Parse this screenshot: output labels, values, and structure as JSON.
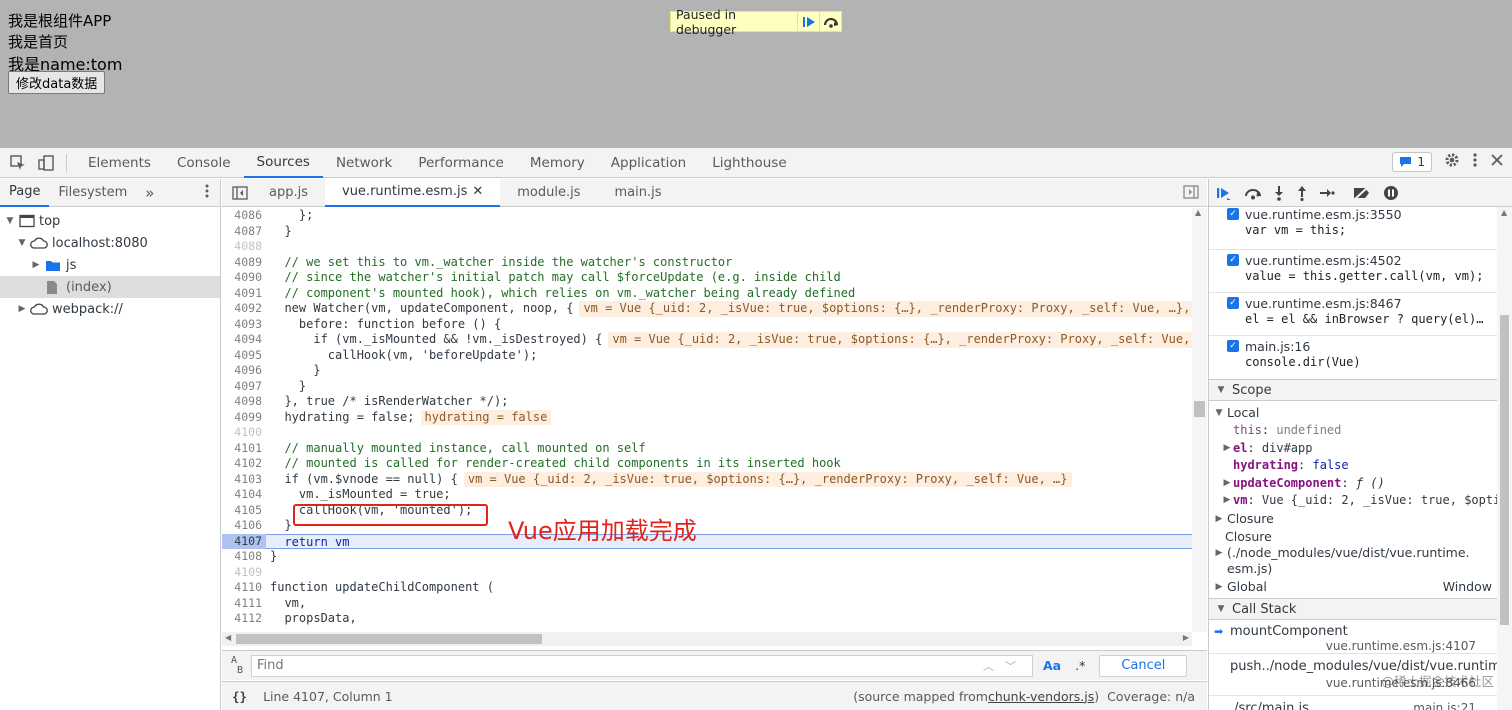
{
  "page": {
    "line1": "我是根组件APP",
    "line2": "我是首页",
    "line3": "我是name:tom",
    "button_label": "修改data数据",
    "paused_text": "Paused in debugger"
  },
  "devtools": {
    "tabs": [
      "Elements",
      "Console",
      "Sources",
      "Network",
      "Performance",
      "Memory",
      "Application",
      "Lighthouse"
    ],
    "active_tab": "Sources",
    "message_count": "1"
  },
  "navigator": {
    "tabs": [
      "Page",
      "Filesystem"
    ],
    "tree": {
      "top": "top",
      "host": "localhost:8080",
      "js": "js",
      "index": "(index)",
      "webpack": "webpack://"
    }
  },
  "editor": {
    "file_tabs": [
      "app.js",
      "vue.runtime.esm.js",
      "module.js",
      "main.js"
    ],
    "active_file": "vue.runtime.esm.js",
    "annotation": "Vue应用加载完成",
    "find_placeholder": "Find",
    "find_case": "Aa",
    "find_regex": ".*",
    "cancel_label": "Cancel",
    "status_position": "Line 4107, Column 1",
    "status_mapped_prefix": "(source mapped from ",
    "status_mapped_file": "chunk-vendors.js",
    "status_mapped_suffix": ")",
    "status_coverage": "Coverage: n/a"
  },
  "code_lines": [
    {
      "n": "4086",
      "t": "    };"
    },
    {
      "n": "4087",
      "t": "  }"
    },
    {
      "n": "4088",
      "t": ""
    },
    {
      "n": "4089",
      "t": "  // we set this to vm._watcher inside the watcher's constructor"
    },
    {
      "n": "4090",
      "t": "  // since the watcher's initial patch may call $forceUpdate (e.g. inside child"
    },
    {
      "n": "4091",
      "t": "  // component's mounted hook), which relies on vm._watcher being already defined"
    },
    {
      "n": "4092",
      "t": "  new Watcher(vm, updateComponent, noop, {",
      "i": "vm = Vue {_uid: 2, _isVue: true, $options: {…}, _renderProxy: Proxy, _self: Vue, …},"
    },
    {
      "n": "4093",
      "t": "    before: function before () {"
    },
    {
      "n": "4094",
      "t": "      if (vm._isMounted && !vm._isDestroyed) {",
      "i": "vm = Vue {_uid: 2, _isVue: true, $options: {…}, _renderProxy: Proxy, _self: Vue,"
    },
    {
      "n": "4095",
      "t": "        callHook(vm, 'beforeUpdate');"
    },
    {
      "n": "4096",
      "t": "      }"
    },
    {
      "n": "4097",
      "t": "    }"
    },
    {
      "n": "4098",
      "t": "  }, true /* isRenderWatcher */);"
    },
    {
      "n": "4099",
      "t": "  hydrating = false;",
      "i": "hydrating = false"
    },
    {
      "n": "4100",
      "t": ""
    },
    {
      "n": "4101",
      "t": "  // manually mounted instance, call mounted on self"
    },
    {
      "n": "4102",
      "t": "  // mounted is called for render-created child components in its inserted hook"
    },
    {
      "n": "4103",
      "t": "  if (vm.$vnode == null) {",
      "i": "vm = Vue {_uid: 2, _isVue: true, $options: {…}, _renderProxy: Proxy, _self: Vue, …}"
    },
    {
      "n": "4104",
      "t": "    vm._isMounted = true;"
    },
    {
      "n": "4105",
      "t": "    callHook(vm, 'mounted');"
    },
    {
      "n": "4106",
      "t": "  }"
    },
    {
      "n": "4107",
      "t": "  return vm"
    },
    {
      "n": "4108",
      "t": "}"
    },
    {
      "n": "4109",
      "t": ""
    },
    {
      "n": "4110",
      "t": "function updateChildComponent ("
    },
    {
      "n": "4111",
      "t": "  vm,"
    },
    {
      "n": "4112",
      "t": "  propsData,"
    }
  ],
  "breakpoints": [
    {
      "loc": "vue.runtime.esm.js:3550",
      "code": "var vm = this;"
    },
    {
      "loc": "vue.runtime.esm.js:4502",
      "code": "value = this.getter.call(vm, vm);"
    },
    {
      "loc": "vue.runtime.esm.js:8467",
      "code": "el = el && inBrowser ? query(el)…"
    },
    {
      "loc": "main.js:16",
      "code": "console.dir(Vue)"
    }
  ],
  "scope": {
    "title": "Scope",
    "local": "Local",
    "this_name": "this",
    "this_val": "undefined",
    "el_name": "el",
    "el_val": "div#app",
    "hydrating_name": "hydrating",
    "hydrating_val": "false",
    "update_name": "updateComponent",
    "update_val": "ƒ ()",
    "vm_name": "vm",
    "vm_val": "Vue {_uid: 2, _isVue: true, $opti",
    "closure1": "Closure",
    "closure2": "Closure",
    "closure2_path1": "(./node_modules/vue/dist/vue.runtime.",
    "closure2_path2": "esm.js)",
    "global": "Global",
    "global_val": "Window"
  },
  "callstack": {
    "title": "Call Stack",
    "items": [
      {
        "fn": "mountComponent",
        "loc": "vue.runtime.esm.js:4107"
      },
      {
        "fn": "push../node_modules/vue/dist/vue.runtime…",
        "loc": "vue.runtime.esm.js:8466"
      },
      {
        "fn": "./src/main.js",
        "loc": "main.js:21"
      }
    ]
  },
  "watermark": "@稀土掘金技术社区",
  "colors": {
    "accent": "#1a73e8",
    "annotation": "#e2231a",
    "page_bg": "#b3b3b3",
    "paused_bg": "#ffffc2"
  }
}
